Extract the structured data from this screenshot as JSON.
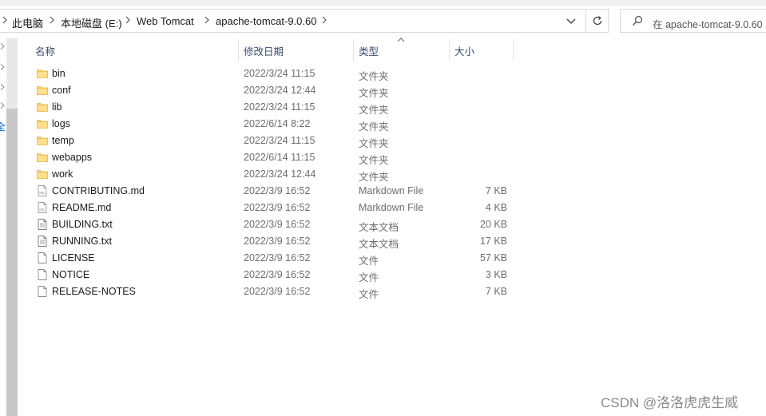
{
  "breadcrumb": {
    "items": [
      "此电脑",
      "本地磁盘 (E:)",
      "Web Tomcat",
      "apache-tomcat-9.0.60"
    ]
  },
  "search": {
    "placeholder": "在 apache-tomcat-9.0.60"
  },
  "columns": {
    "name": "名称",
    "date": "修改日期",
    "type": "类型",
    "size": "大小"
  },
  "nav": {
    "partial_label": "全"
  },
  "files": [
    {
      "name": "bin",
      "date": "2022/3/24 11:15",
      "type": "文件夹",
      "size": "",
      "icon": "folder-icon"
    },
    {
      "name": "conf",
      "date": "2022/3/24 12:44",
      "type": "文件夹",
      "size": "",
      "icon": "folder-icon"
    },
    {
      "name": "lib",
      "date": "2022/3/24 11:15",
      "type": "文件夹",
      "size": "",
      "icon": "folder-icon"
    },
    {
      "name": "logs",
      "date": "2022/6/14 8:22",
      "type": "文件夹",
      "size": "",
      "icon": "folder-icon"
    },
    {
      "name": "temp",
      "date": "2022/3/24 11:15",
      "type": "文件夹",
      "size": "",
      "icon": "folder-icon"
    },
    {
      "name": "webapps",
      "date": "2022/6/14 11:15",
      "type": "文件夹",
      "size": "",
      "icon": "folder-icon"
    },
    {
      "name": "work",
      "date": "2022/3/24 12:44",
      "type": "文件夹",
      "size": "",
      "icon": "folder-icon"
    },
    {
      "name": "CONTRIBUTING.md",
      "date": "2022/3/9 16:52",
      "type": "Markdown File",
      "size": "7 KB",
      "icon": "markdown-file-icon"
    },
    {
      "name": "README.md",
      "date": "2022/3/9 16:52",
      "type": "Markdown File",
      "size": "4 KB",
      "icon": "markdown-file-icon"
    },
    {
      "name": "BUILDING.txt",
      "date": "2022/3/9 16:52",
      "type": "文本文档",
      "size": "20 KB",
      "icon": "text-file-icon"
    },
    {
      "name": "RUNNING.txt",
      "date": "2022/3/9 16:52",
      "type": "文本文档",
      "size": "17 KB",
      "icon": "text-file-icon"
    },
    {
      "name": "LICENSE",
      "date": "2022/3/9 16:52",
      "type": "文件",
      "size": "57 KB",
      "icon": "blank-file-icon"
    },
    {
      "name": "NOTICE",
      "date": "2022/3/9 16:52",
      "type": "文件",
      "size": "3 KB",
      "icon": "blank-file-icon"
    },
    {
      "name": "RELEASE-NOTES",
      "date": "2022/3/9 16:52",
      "type": "文件",
      "size": "7 KB",
      "icon": "blank-file-icon"
    }
  ],
  "watermark": "CSDN @洛洛虎虎生威"
}
